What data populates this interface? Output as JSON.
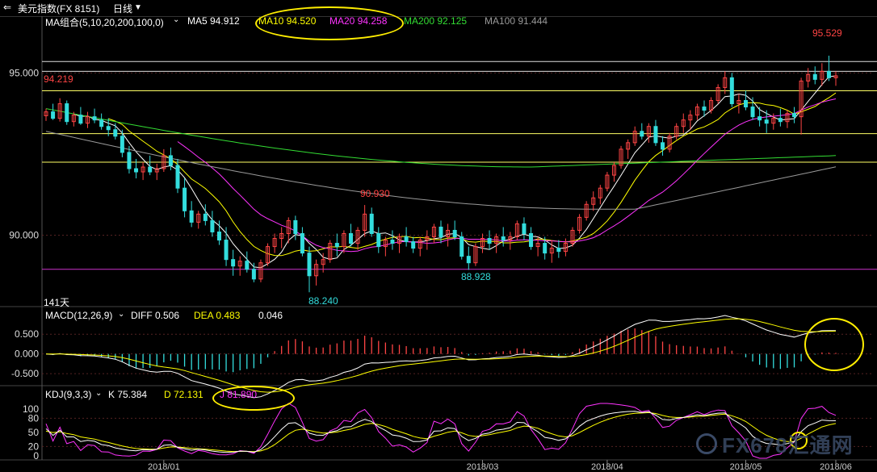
{
  "topbar": {
    "title": "美元指数(FX 8151)",
    "period": "日线",
    "period_chevron": "chevron-down-icon"
  },
  "price_panel": {
    "indicator": "MA组合(5,10,20,200,100,0)",
    "ma": [
      {
        "label": "MA5 94.912",
        "color": "#ffffff"
      },
      {
        "label": "MA10 94.520",
        "color": "#ffff00"
      },
      {
        "label": "MA20 94.258",
        "color": "#ff33ff"
      },
      {
        "label": "MA200 92.125",
        "color": "#33dd33"
      },
      {
        "label": "MA100 91.444",
        "color": "#999999"
      }
    ],
    "annotations": {
      "high_right": "95.529",
      "left_value": "94.219",
      "peak_mid": "90.930",
      "low_left": "88.240",
      "low_mid": "88.928",
      "days": "141天"
    }
  },
  "macd_panel": {
    "indicator": "MACD(12,26,9)",
    "diff": "DIFF 0.506",
    "dea": "DEA 0.483",
    "macd": "0.046"
  },
  "kdj_panel": {
    "indicator": "KDJ(9,3,3)",
    "k": "K 75.384",
    "d": "D 72.131",
    "j": "J 81.890"
  },
  "watermark": "FX678汇通网",
  "colors": {
    "up": "#ff4444",
    "down": "#33dddd",
    "ma5": "#ffffff",
    "ma10": "#ffff00",
    "ma20": "#ff33ff",
    "ma200": "#33dd33",
    "ma100": "#999999",
    "hline_yellow": "#ffff66",
    "hline_magenta": "#cc33cc",
    "ellipse": "#ffee00",
    "grid": "#333333"
  },
  "chart_data": [
    {
      "type": "candlestick",
      "title": "美元指数(FX 8151) 日线",
      "y_ticks": [
        95.0,
        90.0
      ],
      "ylim": [
        87.85,
        96.45
      ],
      "x_tick_labels": [
        "2018/01",
        "2018/03",
        "2018/04",
        "2018/05",
        "2018/06"
      ],
      "horizontal_lines": [
        95.35,
        95.05,
        94.45,
        93.13,
        92.25,
        88.95
      ],
      "series_ohlc": [
        [
          93.68,
          93.9,
          93.52,
          93.8
        ],
        [
          93.8,
          94.05,
          93.55,
          93.6
        ],
        [
          93.6,
          94.22,
          93.5,
          94.05
        ],
        [
          94.05,
          94.15,
          93.4,
          93.5
        ],
        [
          93.5,
          93.8,
          93.35,
          93.7
        ],
        [
          93.7,
          93.95,
          93.4,
          93.45
        ],
        [
          93.45,
          93.8,
          93.3,
          93.65
        ],
        [
          93.65,
          93.9,
          93.45,
          93.55
        ],
        [
          93.55,
          93.75,
          93.25,
          93.35
        ],
        [
          93.35,
          93.6,
          93.05,
          93.25
        ],
        [
          93.25,
          93.45,
          92.95,
          93.05
        ],
        [
          93.05,
          93.25,
          92.4,
          92.55
        ],
        [
          92.55,
          92.75,
          91.9,
          92.05
        ],
        [
          92.05,
          92.35,
          91.75,
          91.95
        ],
        [
          91.95,
          92.25,
          91.7,
          92.1
        ],
        [
          92.1,
          92.45,
          91.85,
          91.95
        ],
        [
          91.95,
          92.2,
          91.7,
          92.05
        ],
        [
          92.05,
          92.65,
          91.95,
          92.45
        ],
        [
          92.45,
          92.7,
          92.0,
          92.15
        ],
        [
          92.15,
          92.35,
          91.3,
          91.45
        ],
        [
          91.45,
          91.75,
          90.55,
          90.75
        ],
        [
          90.75,
          91.05,
          90.25,
          90.4
        ],
        [
          90.4,
          90.75,
          90.2,
          90.65
        ],
        [
          90.65,
          90.95,
          90.3,
          90.45
        ],
        [
          90.45,
          90.75,
          89.95,
          90.1
        ],
        [
          90.1,
          90.45,
          89.7,
          89.85
        ],
        [
          89.85,
          90.25,
          89.05,
          89.25
        ],
        [
          89.25,
          89.55,
          88.75,
          89.05
        ],
        [
          89.05,
          89.35,
          88.75,
          89.2
        ],
        [
          89.2,
          89.5,
          88.85,
          88.95
        ],
        [
          88.95,
          89.15,
          88.55,
          88.65
        ],
        [
          88.65,
          89.25,
          88.55,
          89.15
        ],
        [
          89.15,
          89.75,
          89.05,
          89.65
        ],
        [
          89.65,
          90.05,
          89.45,
          89.9
        ],
        [
          89.9,
          90.25,
          89.6,
          90.05
        ],
        [
          90.05,
          90.55,
          89.75,
          90.45
        ],
        [
          90.45,
          90.6,
          89.85,
          90.05
        ],
        [
          90.05,
          90.25,
          89.35,
          89.45
        ],
        [
          89.45,
          89.65,
          88.24,
          88.75
        ],
        [
          88.75,
          89.25,
          88.45,
          89.1
        ],
        [
          89.1,
          89.45,
          88.85,
          89.25
        ],
        [
          89.25,
          89.85,
          89.15,
          89.75
        ],
        [
          89.75,
          90.05,
          89.35,
          89.65
        ],
        [
          89.65,
          90.15,
          89.45,
          90.05
        ],
        [
          90.05,
          90.35,
          89.65,
          89.75
        ],
        [
          89.75,
          90.25,
          89.55,
          90.15
        ],
        [
          90.15,
          90.93,
          89.95,
          90.65
        ],
        [
          90.65,
          90.85,
          89.95,
          90.05
        ],
        [
          90.05,
          90.25,
          89.45,
          89.65
        ],
        [
          89.65,
          89.95,
          89.35,
          89.85
        ],
        [
          89.85,
          90.15,
          89.55,
          89.75
        ],
        [
          89.75,
          90.05,
          89.45,
          89.95
        ],
        [
          89.95,
          90.25,
          89.65,
          89.8
        ],
        [
          89.8,
          89.95,
          89.45,
          89.6
        ],
        [
          89.6,
          89.95,
          89.35,
          89.85
        ],
        [
          89.85,
          90.15,
          89.55,
          89.95
        ],
        [
          89.95,
          90.35,
          89.75,
          90.25
        ],
        [
          90.25,
          90.45,
          89.75,
          89.95
        ],
        [
          89.95,
          90.35,
          89.65,
          90.15
        ],
        [
          90.15,
          90.45,
          89.85,
          89.95
        ],
        [
          89.95,
          90.1,
          89.25,
          89.35
        ],
        [
          89.35,
          89.65,
          88.93,
          89.15
        ],
        [
          89.15,
          89.75,
          89.05,
          89.65
        ],
        [
          89.65,
          90.05,
          89.45,
          89.9
        ],
        [
          89.9,
          90.15,
          89.55,
          89.75
        ],
        [
          89.75,
          90.05,
          89.45,
          89.95
        ],
        [
          89.95,
          90.25,
          89.65,
          89.85
        ],
        [
          89.85,
          90.1,
          89.55,
          89.95
        ],
        [
          89.95,
          90.45,
          89.85,
          90.35
        ],
        [
          90.35,
          90.55,
          89.85,
          90.05
        ],
        [
          90.05,
          90.25,
          89.55,
          89.65
        ],
        [
          89.65,
          89.95,
          89.35,
          89.75
        ],
        [
          89.75,
          89.95,
          89.25,
          89.45
        ],
        [
          89.45,
          89.85,
          89.15,
          89.6
        ],
        [
          89.6,
          89.85,
          89.3,
          89.5
        ],
        [
          89.5,
          89.9,
          89.35,
          89.75
        ],
        [
          89.75,
          90.25,
          89.65,
          90.15
        ],
        [
          90.15,
          90.65,
          90.05,
          90.55
        ],
        [
          90.55,
          91.05,
          90.45,
          90.95
        ],
        [
          90.95,
          91.35,
          90.75,
          91.15
        ],
        [
          91.15,
          91.55,
          90.95,
          91.45
        ],
        [
          91.45,
          91.95,
          91.35,
          91.85
        ],
        [
          91.85,
          92.25,
          91.65,
          92.15
        ],
        [
          92.15,
          92.75,
          92.05,
          92.65
        ],
        [
          92.65,
          92.95,
          92.35,
          92.85
        ],
        [
          92.85,
          93.35,
          92.75,
          93.2
        ],
        [
          93.2,
          93.45,
          92.95,
          93.05
        ],
        [
          93.05,
          93.45,
          92.85,
          93.35
        ],
        [
          93.35,
          93.55,
          92.75,
          92.85
        ],
        [
          92.85,
          93.05,
          92.45,
          92.65
        ],
        [
          92.65,
          93.15,
          92.55,
          93.05
        ],
        [
          93.05,
          93.45,
          92.95,
          93.35
        ],
        [
          93.35,
          93.75,
          93.15,
          93.55
        ],
        [
          93.55,
          93.85,
          93.25,
          93.7
        ],
        [
          93.7,
          94.05,
          93.55,
          93.95
        ],
        [
          93.95,
          94.15,
          93.65,
          93.85
        ],
        [
          93.85,
          94.25,
          93.75,
          94.15
        ],
        [
          94.15,
          94.65,
          94.05,
          94.55
        ],
        [
          94.55,
          95.05,
          94.35,
          94.85
        ],
        [
          94.85,
          95.0,
          93.95,
          94.05
        ],
        [
          94.05,
          94.35,
          93.75,
          94.15
        ],
        [
          94.15,
          94.45,
          93.85,
          93.95
        ],
        [
          93.95,
          94.25,
          93.55,
          93.65
        ],
        [
          93.65,
          93.95,
          93.35,
          93.55
        ],
        [
          93.55,
          93.85,
          93.15,
          93.45
        ],
        [
          93.45,
          93.75,
          93.25,
          93.6
        ],
        [
          93.6,
          93.9,
          93.35,
          93.5
        ],
        [
          93.5,
          93.85,
          93.3,
          93.75
        ],
        [
          93.75,
          93.95,
          93.45,
          93.65
        ],
        [
          93.65,
          94.85,
          93.1,
          94.75
        ],
        [
          94.75,
          95.15,
          94.55,
          94.95
        ],
        [
          94.95,
          95.2,
          94.65,
          94.8
        ],
        [
          94.8,
          95.3,
          94.6,
          95.05
        ],
        [
          95.05,
          95.53,
          94.75,
          94.85
        ],
        [
          94.85,
          95.05,
          94.6,
          94.91
        ]
      ]
    },
    {
      "type": "macd",
      "title": "MACD(12,26,9)",
      "y_ticks": [
        0.5,
        0.0,
        -0.5
      ],
      "ylim": [
        -0.6,
        0.75
      ],
      "diff_last": 0.506,
      "dea_last": 0.483,
      "macd_last": 0.046
    },
    {
      "type": "kdj",
      "title": "KDJ(9,3,3)",
      "y_ticks": [
        100,
        80,
        50,
        20,
        0
      ],
      "ylim": [
        -5,
        115
      ],
      "k_last": 75.384,
      "d_last": 72.131,
      "j_last": 81.89
    }
  ]
}
